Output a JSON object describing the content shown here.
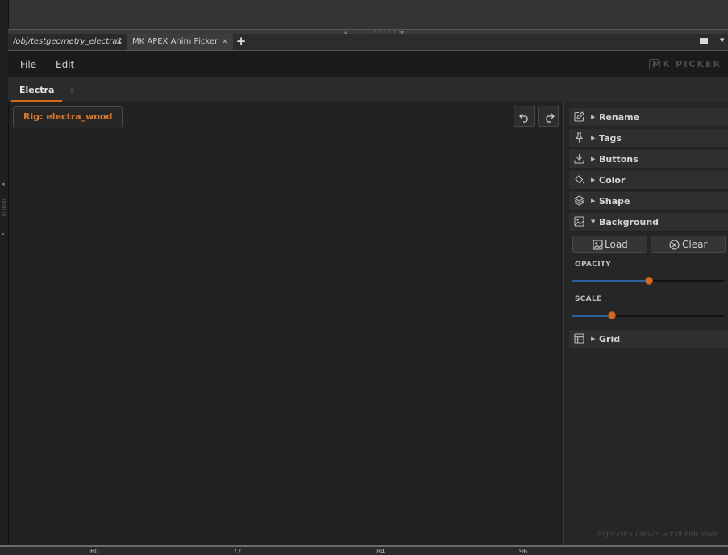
{
  "tabs": {
    "path_label": "/obj/testgeometry_electra1",
    "picker_label": "MK APEX Anim Picker",
    "close_glyph": "×",
    "add_glyph": "+"
  },
  "menu": {
    "file": "File",
    "edit": "Edit"
  },
  "brand": {
    "text": "MK PICKER",
    "icon": "bolt-icon"
  },
  "picker_tabs": {
    "active": "Electra",
    "add_glyph": "+"
  },
  "canvas": {
    "rig_label": "Rig: electra_wood"
  },
  "panel": {
    "sections": {
      "rename": "Rename",
      "tags": "Tags",
      "buttons": "Buttons",
      "color": "Color",
      "shape": "Shape",
      "background": "Background",
      "grid": "Grid"
    },
    "background": {
      "expanded": true,
      "load_label": "Load",
      "clear_label": "Clear",
      "opacity_label": "OPACITY",
      "opacity_value": 0.5,
      "scale_label": "SCALE",
      "scale_value": 0.26
    },
    "hint": "Right-click canvas → Exit Edit Mode"
  },
  "ruler": {
    "ticks": [
      "60",
      "72",
      "84",
      "96"
    ]
  },
  "colors": {
    "accent": "#d46b1c",
    "slider_fill": "#2b5f9e",
    "rig_text": "#d97a2b"
  }
}
